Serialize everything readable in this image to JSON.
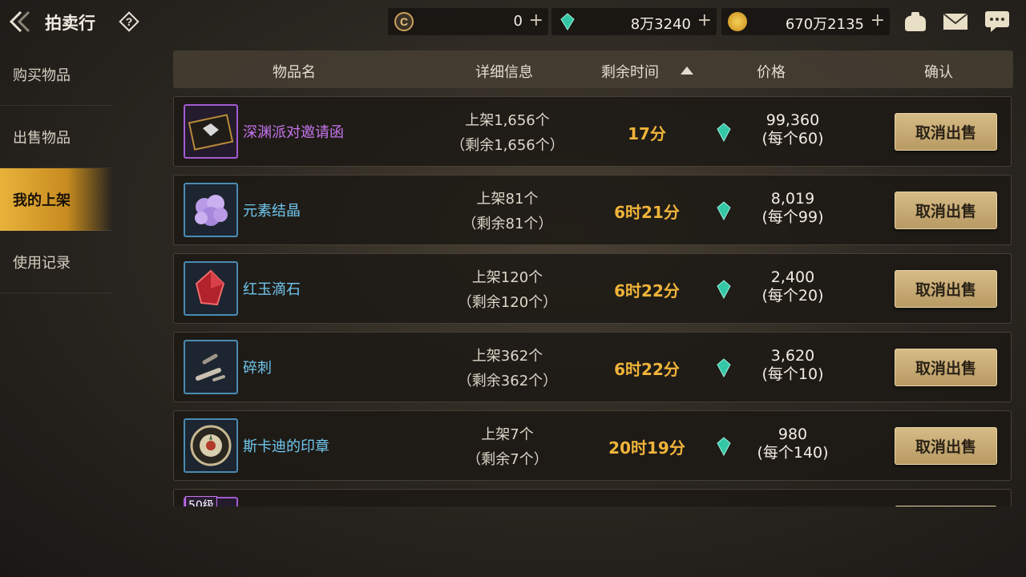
{
  "header": {
    "title": "拍卖行",
    "back_icon": "back-arrow-icon",
    "help_icon": "question-diamond-icon"
  },
  "currencies": [
    {
      "name": "c-coin",
      "value": "0",
      "icon": "c-coin-icon",
      "color": "#caa15a"
    },
    {
      "name": "gem",
      "value": "8万3240",
      "icon": "green-gem-icon",
      "color": "#34c7a6"
    },
    {
      "name": "gold",
      "value": "670万2135",
      "icon": "gold-coin-icon",
      "color": "#e0a92a"
    }
  ],
  "top_icons": [
    "pouch-icon",
    "mail-icon",
    "chat-icon"
  ],
  "sidebar": {
    "items": [
      {
        "label": "购买物品",
        "active": false
      },
      {
        "label": "出售物品",
        "active": false
      },
      {
        "label": "我的上架",
        "active": true
      },
      {
        "label": "使用记录",
        "active": false
      }
    ]
  },
  "table": {
    "headers": {
      "name": "物品名",
      "detail": "详细信息",
      "time": "剩余时间",
      "price": "价格",
      "confirm": "确认"
    },
    "rows": [
      {
        "name": "深渊派对邀请函",
        "rarity": "purple",
        "listed": "上架1,656个",
        "remaining": "（剩余1,656个）",
        "time": "17分",
        "price": "99,360",
        "unit": "(每个60)",
        "action": "取消出售",
        "icon": "invitation-card-icon"
      },
      {
        "name": "元素结晶",
        "rarity": "blue",
        "listed": "上架81个",
        "remaining": "（剩余81个）",
        "time": "6时21分",
        "price": "8,019",
        "unit": "(每个99)",
        "action": "取消出售",
        "icon": "purple-crystal-cluster-icon"
      },
      {
        "name": "红玉滴石",
        "rarity": "blue",
        "listed": "上架120个",
        "remaining": "（剩余120个）",
        "time": "6时22分",
        "price": "2,400",
        "unit": "(每个20)",
        "action": "取消出售",
        "icon": "red-gem-icon"
      },
      {
        "name": "碎刺",
        "rarity": "blue",
        "listed": "上架362个",
        "remaining": "（剩余362个）",
        "time": "6时22分",
        "price": "3,620",
        "unit": "(每个10)",
        "action": "取消出售",
        "icon": "broken-thorn-icon"
      },
      {
        "name": "斯卡迪的印章",
        "rarity": "blue",
        "listed": "上架7个",
        "remaining": "（剩余7个）",
        "time": "20时19分",
        "price": "980",
        "unit": "(每个140)",
        "action": "取消出售",
        "icon": "seal-emblem-icon"
      }
    ],
    "partial_row_tag": "50级"
  }
}
